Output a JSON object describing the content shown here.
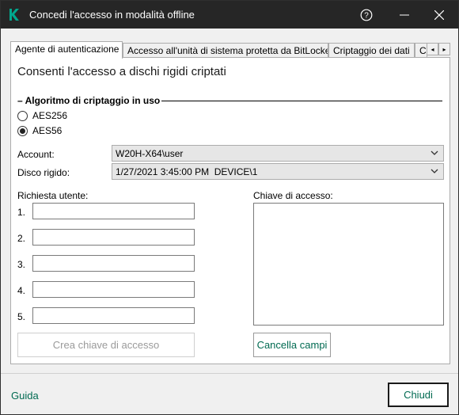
{
  "window": {
    "title": "Concedi l'accesso in modalità offline",
    "logo_icon": "kaspersky-k-logo",
    "help_icon": "help-icon",
    "minimize_icon": "minimize-icon",
    "close_icon": "close-icon"
  },
  "tabs": [
    {
      "label": "Agente di autenticazione",
      "active": true
    },
    {
      "label": "Accesso all'unità di sistema protetta da BitLocker",
      "active": false
    },
    {
      "label": "Criptaggio dei dati",
      "active": false
    },
    {
      "label": "C",
      "active": false
    }
  ],
  "tab_scroll": {
    "left": "◂",
    "right": "▸"
  },
  "content": {
    "heading": "Consenti l'accesso a dischi rigidi criptati",
    "algorithm_group": "Algoritmo di criptaggio in uso",
    "algorithms": [
      {
        "label": "AES256",
        "checked": false
      },
      {
        "label": "AES56",
        "checked": true
      }
    ],
    "account_label": "Account:",
    "account_value": "W20H-X64\\user",
    "disk_label": "Disco rigido:",
    "disk_value": "1/27/2021 3:45:00 PM  DEVICE\\1",
    "user_request_label": "Richiesta utente:",
    "request_fields": [
      {
        "num": "1.",
        "value": ""
      },
      {
        "num": "2.",
        "value": ""
      },
      {
        "num": "3.",
        "value": ""
      },
      {
        "num": "4.",
        "value": ""
      },
      {
        "num": "5.",
        "value": ""
      }
    ],
    "access_key_label": "Chiave di accesso:",
    "access_key_value": "",
    "create_key_button": "Crea chiave di accesso",
    "clear_fields_button": "Cancella campi"
  },
  "footer": {
    "guide_link": "Guida",
    "close_button": "Chiudi"
  },
  "colors": {
    "titlebar": "#262626",
    "accent_green": "#006a51",
    "logo_green": "#00a88e"
  }
}
